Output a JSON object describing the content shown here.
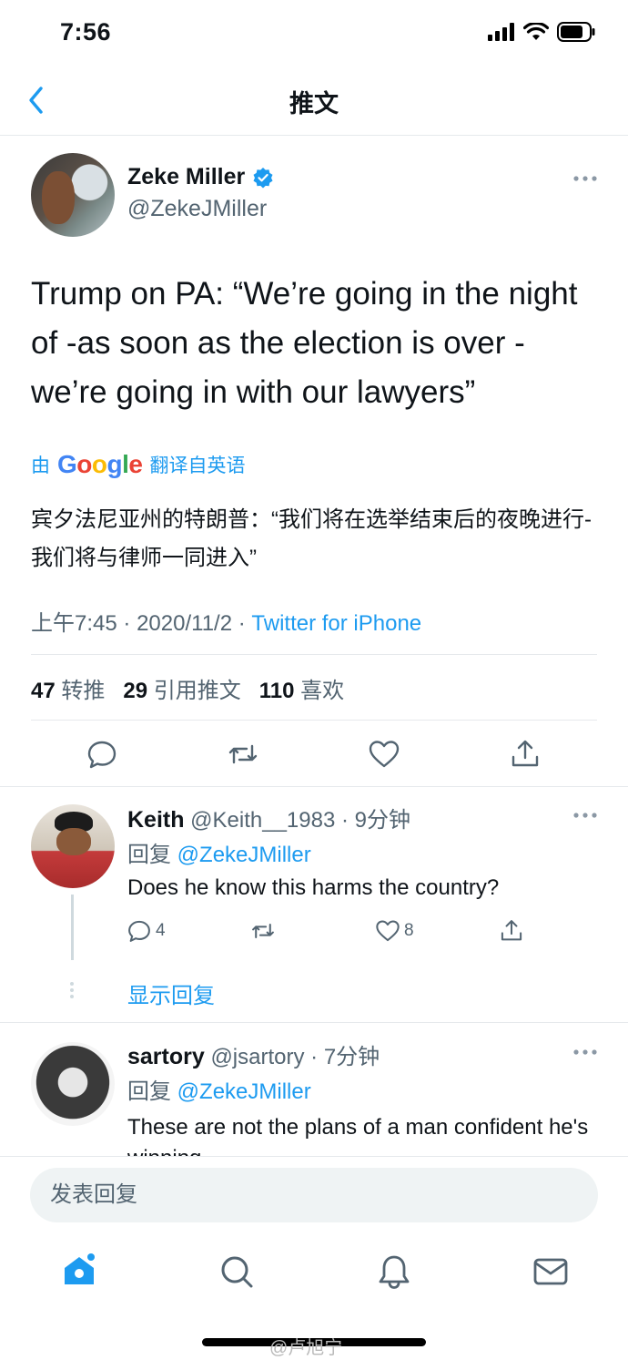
{
  "status_bar": {
    "time": "7:56"
  },
  "nav": {
    "title": "推文"
  },
  "tweet": {
    "display_name": "Zeke Miller",
    "handle": "@ZekeJMiller",
    "text": "Trump on PA: “We’re going in the night of -as soon as the election is over - we’re going in with our lawyers”",
    "translate_prefix": "由",
    "translate_brand": "Google",
    "translate_suffix": "翻译自英语",
    "translation": "宾夕法尼亚州的特朗普：“我们将在选举结束后的夜晚进行-我们将与律师一同进入”",
    "time": "上午7:45",
    "date": "2020/11/2",
    "separator": "·",
    "source": "Twitter for iPhone",
    "retweets_count": "47",
    "retweets_label": "转推",
    "quotes_count": "29",
    "quotes_label": "引用推文",
    "likes_count": "110",
    "likes_label": "喜欢"
  },
  "replies": [
    {
      "display_name": "Keith",
      "handle": "@Keith__1983",
      "separator": "·",
      "time": "9分钟",
      "reply_prefix": "回复",
      "reply_to": "@ZekeJMiller",
      "text": "Does he know this harms the country?",
      "reply_count": "4",
      "like_count": "8",
      "show_replies": "显示回复"
    },
    {
      "display_name": "sartory",
      "handle": "@jsartory",
      "separator": "·",
      "time": "7分钟",
      "reply_prefix": "回复",
      "reply_to": "@ZekeJMiller",
      "text": "These are not the plans of a man confident he's winning"
    }
  ],
  "compose": {
    "placeholder": "发表回复"
  },
  "watermark": "@卢旭宁",
  "icons": {
    "back": "chevron-left-icon",
    "verified": "verified-badge-icon",
    "more": "more-horizontal-icon",
    "reply": "comment-icon",
    "retweet": "retweet-icon",
    "like": "heart-icon",
    "share": "share-icon",
    "home": "home-icon",
    "search": "search-icon",
    "notifications": "bell-icon",
    "messages": "mail-icon"
  },
  "colors": {
    "accent": "#1d9bf0",
    "text": "#0f1419",
    "secondary": "#536471",
    "divider": "#e6e9ec"
  }
}
